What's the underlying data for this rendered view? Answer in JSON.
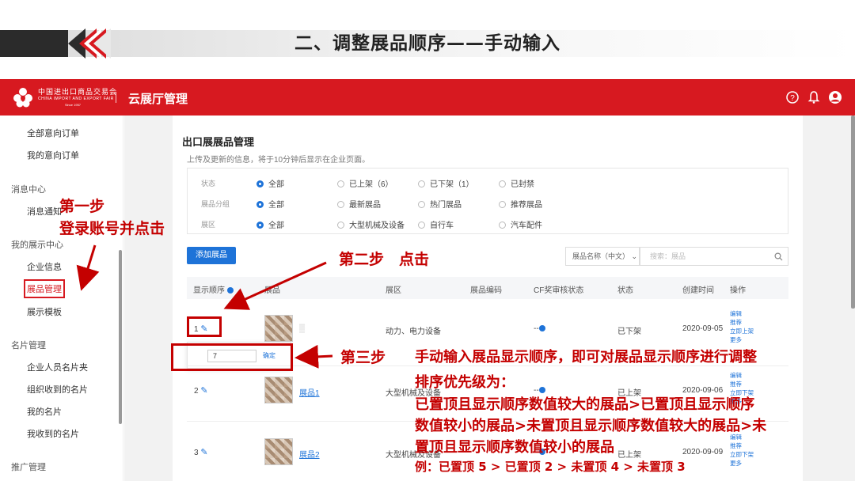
{
  "slide": {
    "title": "二、调整展品顺序——手动输入"
  },
  "header": {
    "logo_cn": "中国进出口商品交易会",
    "logo_en": "CHINA IMPORT AND EXPORT FAIR",
    "logo_since": "Since 1957",
    "app_title": "云展厅管理",
    "icons": [
      "help-icon",
      "bell-icon",
      "user-icon"
    ]
  },
  "sidebar": {
    "items": [
      {
        "label": "全部意向订单",
        "type": "item"
      },
      {
        "label": "我的意向订单",
        "type": "item"
      },
      {
        "label": "消息中心",
        "type": "group"
      },
      {
        "label": "消息通知",
        "type": "item"
      },
      {
        "label": "我的展示中心",
        "type": "group"
      },
      {
        "label": "企业信息",
        "type": "item"
      },
      {
        "label": "展品管理",
        "type": "item",
        "active": true
      },
      {
        "label": "展示模板",
        "type": "item"
      },
      {
        "label": "名片管理",
        "type": "group"
      },
      {
        "label": "企业人员名片夹",
        "type": "item"
      },
      {
        "label": "组织收到的名片",
        "type": "item"
      },
      {
        "label": "我的名片",
        "type": "item"
      },
      {
        "label": "我收到的名片",
        "type": "item"
      },
      {
        "label": "推广管理",
        "type": "group"
      }
    ]
  },
  "page": {
    "title": "出口展展品管理",
    "subtitle": "上传及更新的信息，将于10分钟后显示在企业页面。",
    "filters": [
      {
        "label": "状态",
        "options": [
          "全部",
          "已上架（6）",
          "已下架（1）",
          "已封禁"
        ],
        "selected": 0
      },
      {
        "label": "展品分组",
        "options": [
          "全部",
          "最新展品",
          "热门展品",
          "推荐展品"
        ],
        "selected": 0
      },
      {
        "label": "展区",
        "options": [
          "全部",
          "大型机械及设备",
          "自行车",
          "汽车配件"
        ],
        "selected": 0
      }
    ],
    "add_button": "添加展品",
    "search_select": "展品名称（中文）",
    "search_placeholder": "搜索：展品"
  },
  "table": {
    "headers": [
      "显示顺序",
      "展品",
      "展区",
      "展品编码",
      "CF奖审核状态",
      "状态",
      "创建时间",
      "操作"
    ],
    "rows": [
      {
        "order": "1",
        "name": "",
        "zone": "动力、电力设备",
        "code": "",
        "cf": "--",
        "status": "已下架",
        "created": "2020-09-05",
        "ops": [
          "编辑",
          "推荐",
          "立即上架",
          "更多"
        ]
      },
      {
        "order": "2",
        "name": "展品1",
        "zone": "大型机械及设备",
        "code": "",
        "cf": "--",
        "status": "已上架",
        "created": "2020-09-06",
        "ops": [
          "编辑",
          "推荐",
          "立即下架",
          "更多"
        ]
      },
      {
        "order": "3",
        "name": "展品2",
        "zone": "大型机械及设备",
        "code": "",
        "cf": "--",
        "status": "已上架",
        "created": "2020-09-09",
        "ops": [
          "编辑",
          "推荐",
          "立即下架",
          "更多"
        ]
      }
    ],
    "edit_popup": {
      "value": "7",
      "confirm": "确定"
    }
  },
  "annotations": {
    "step1_a": "第一步",
    "step1_b": "登录账号并点击",
    "step2": "第二步　点击",
    "step3": "第三步",
    "step3_desc": "手动输入展品显示顺序，即可对展品显示顺序进行调整",
    "priority_title": "排序优先级为：",
    "priority_line1": "已置顶且显示顺序数值较大的展品>已置顶且显示顺序",
    "priority_line2": "数值较小的展品>未置顶且显示顺序数值较大的展品>未",
    "priority_line3": "置顶且显示顺序数值较小的展品",
    "example": "例：已置顶 5 > 已置顶 2 > 未置顶 4 > 未置顶 3",
    "accent_color": "#c40000"
  },
  "colors": {
    "header_red": "#d71920",
    "primary_blue": "#1e73d8"
  }
}
